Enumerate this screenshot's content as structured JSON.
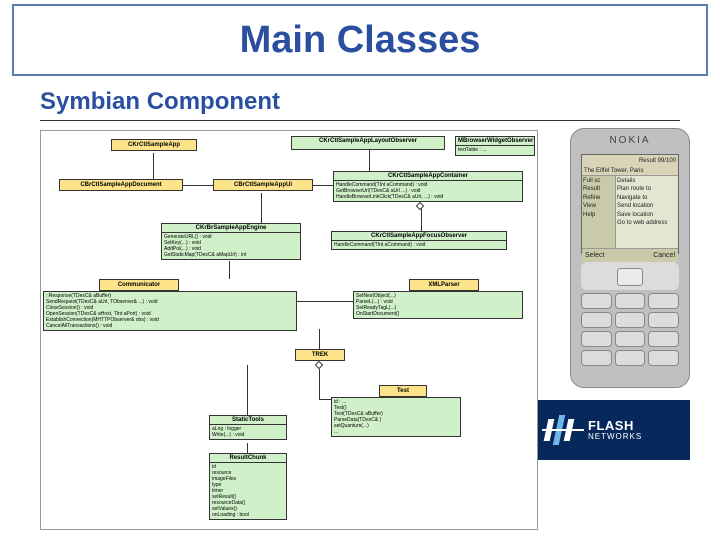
{
  "title": "Main Classes",
  "subtitle": "Symbian Component",
  "diagram": {
    "classes": {
      "app": {
        "name": "CKrCtlSampleApp"
      },
      "document": {
        "name": "CBrCtlSampleAppDocument"
      },
      "appui": {
        "name": "CBrCtlSampleAppUi"
      },
      "layout": {
        "name": "CKrCtlSampleAppLayoutObserver"
      },
      "container": {
        "name": "CKrCtlSampleAppContainer",
        "body": "HandleCommand(TInt aCommand) : void\nGetBrowserUrl(TDesC& aUrl ...) : void\nHandleBrowserLinkClick(TDesC& aUrl, ...) : void"
      },
      "widget": {
        "name": "MBrowserWidgetObserver",
        "body": "textTable : ..."
      },
      "engine": {
        "name": "CKrBrSampleAppEngine",
        "body": "GenerateURL() : void\nSetKey(...) : void\nAddPoi(...) : void\nGetStaticMap(TDesC& aMapUrl) : int"
      },
      "focus": {
        "name": "CKrCtlSampleAppFocusObserver",
        "body": "HandleCommand(TInt aCommand) : void"
      },
      "comm_title": "Communicator",
      "comm": {
        "body": "::Response(TDesC& aBuffer)\nSendRequest(TDesC& aUrl, TObserver& ...) : void\nCloseSession() : void\nOpenSession(TDesC& aHost, TInt aPort) : void\nEstablishConnection(MHTTPObserver& obs) : void\nCancelAllTransactions() : void"
      },
      "xml_title": "XMLParser",
      "xml": {
        "body": "SetNextObject(...)\nParseL(...) : void\nSetReadyTagL(...)\nOnStartDocument()"
      },
      "trek": {
        "name": "TREK"
      },
      "test": {
        "name": "Test",
        "body": "id : ...\nTest()\nTest(TDesC& aBuffer)\nParseData(TDesC& )\nsetQuantum(...)\n..."
      },
      "static": {
        "name": "StaticTools",
        "body": "aLog : logger\nWrite(...) : void"
      },
      "result": {
        "name": "ResultChunk",
        "body": "id\nresource\nimageFiles\ntype\ntimer\nsetResult()\nresourceData()\nsetValues()\nonLoading : bool"
      }
    }
  },
  "phone": {
    "brand": "NOKIA",
    "screen": {
      "top_left": "",
      "top_right": "Result 99/100",
      "caption": "The Eiffel Tower, Paris",
      "left_menu": [
        "Full sc",
        "Result",
        "Refine",
        "View",
        "Help"
      ],
      "right_menu": [
        "Details",
        "Plan route to",
        "Navigate to",
        "Send location",
        "Save location",
        "Go to web address"
      ],
      "soft_left": "Select",
      "soft_right": "Cancel"
    }
  },
  "logo": {
    "line1": "FLASH",
    "line2": "NETWORKS"
  }
}
